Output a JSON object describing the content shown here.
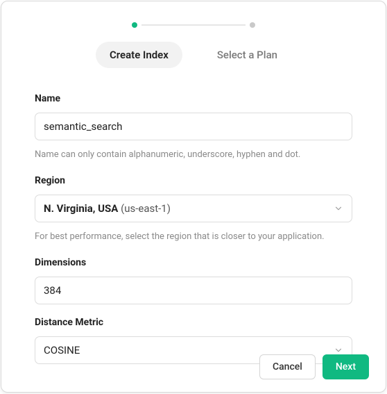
{
  "stepper": {
    "tabs": [
      {
        "label": "Create Index",
        "active": true
      },
      {
        "label": "Select a Plan",
        "active": false
      }
    ]
  },
  "form": {
    "name": {
      "label": "Name",
      "value": "semantic_search",
      "helper": "Name can only contain alphanumeric, underscore, hyphen and dot."
    },
    "region": {
      "label": "Region",
      "selected_bold": "N. Virginia, USA",
      "selected_paren": "(us-east-1)",
      "helper": "For best performance, select the region that is closer to your application."
    },
    "dimensions": {
      "label": "Dimensions",
      "value": "384"
    },
    "distance_metric": {
      "label": "Distance Metric",
      "selected": "COSINE"
    }
  },
  "footer": {
    "cancel": "Cancel",
    "next": "Next"
  }
}
